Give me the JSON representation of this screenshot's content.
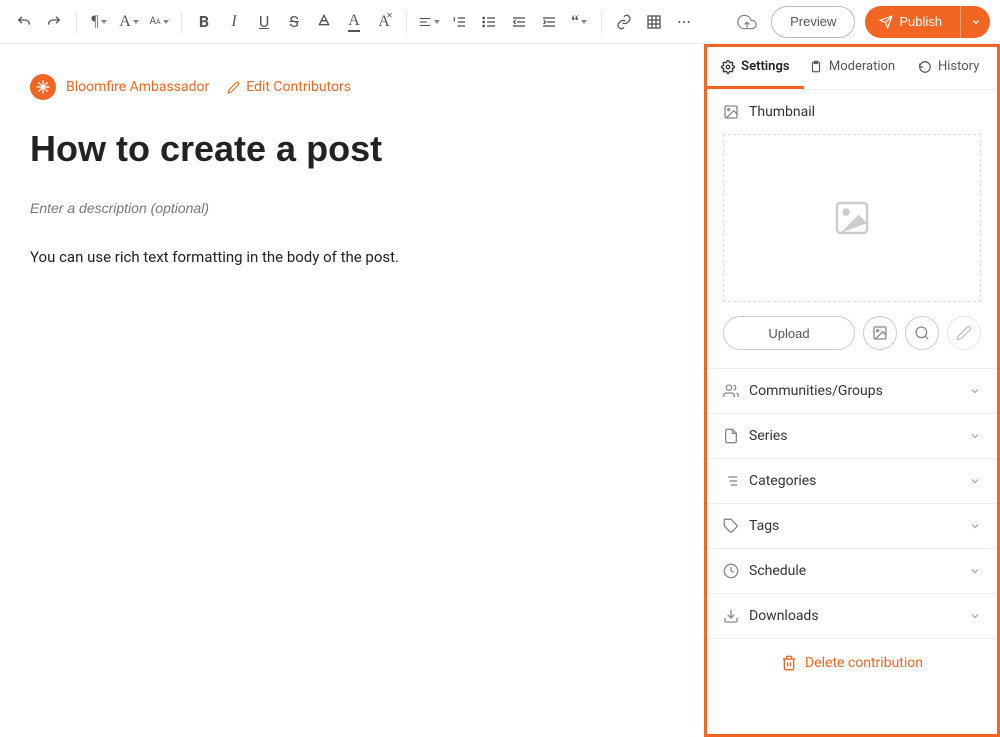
{
  "toolbar": {
    "preview": "Preview",
    "publish": "Publish"
  },
  "editor": {
    "author": "Bloomfire Ambassador",
    "edit_contributors": "Edit Contributors",
    "title": "How to create a post",
    "description_placeholder": "Enter a description (optional)",
    "body": "You can use rich text formatting in the body of the post."
  },
  "sidebar": {
    "tabs": {
      "settings": "Settings",
      "moderation": "Moderation",
      "history": "History"
    },
    "thumbnail": {
      "label": "Thumbnail",
      "upload": "Upload"
    },
    "sections": {
      "communities": "Communities/Groups",
      "series": "Series",
      "categories": "Categories",
      "tags": "Tags",
      "schedule": "Schedule",
      "downloads": "Downloads"
    },
    "delete": "Delete contribution"
  }
}
